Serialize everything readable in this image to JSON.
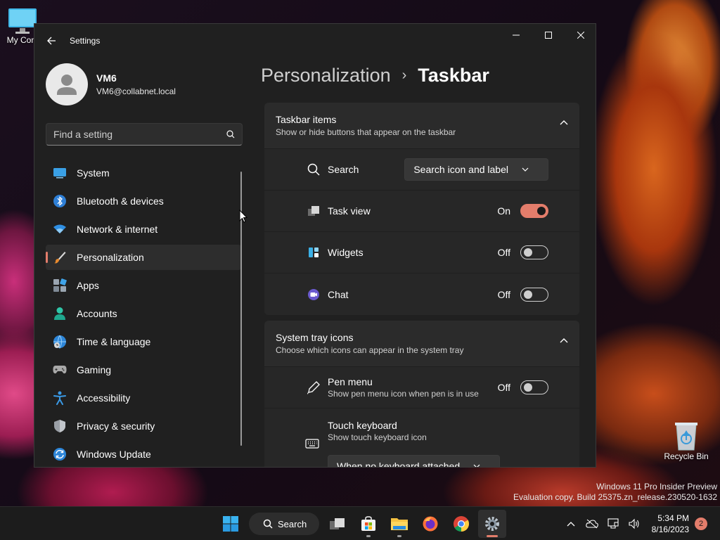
{
  "desktop": {
    "my_computer_label": "My Com",
    "recycle_bin_label": "Recycle Bin"
  },
  "window": {
    "title": "Settings",
    "user": {
      "name": "VM6",
      "email": "VM6@collabnet.local"
    },
    "search": {
      "placeholder": "Find a setting",
      "value": ""
    },
    "nav": [
      {
        "label": "System",
        "icon": "monitor-icon"
      },
      {
        "label": "Bluetooth & devices",
        "icon": "bluetooth-icon"
      },
      {
        "label": "Network & internet",
        "icon": "wifi-icon"
      },
      {
        "label": "Personalization",
        "icon": "paintbrush-icon",
        "active": true
      },
      {
        "label": "Apps",
        "icon": "apps-icon"
      },
      {
        "label": "Accounts",
        "icon": "person-icon"
      },
      {
        "label": "Time & language",
        "icon": "globe-clock-icon"
      },
      {
        "label": "Gaming",
        "icon": "gamepad-icon"
      },
      {
        "label": "Accessibility",
        "icon": "accessibility-icon"
      },
      {
        "label": "Privacy & security",
        "icon": "shield-icon"
      },
      {
        "label": "Windows Update",
        "icon": "update-icon"
      }
    ],
    "breadcrumb": {
      "parent": "Personalization",
      "separator": "›",
      "current": "Taskbar"
    },
    "taskbar_items": {
      "title": "Taskbar items",
      "subtitle": "Show or hide buttons that appear on the taskbar",
      "search": {
        "label": "Search",
        "value": "Search icon and label"
      },
      "task_view": {
        "label": "Task view",
        "state": "On"
      },
      "widgets": {
        "label": "Widgets",
        "state": "Off"
      },
      "chat": {
        "label": "Chat",
        "state": "Off"
      }
    },
    "system_tray": {
      "title": "System tray icons",
      "subtitle": "Choose which icons can appear in the system tray",
      "pen_menu": {
        "label": "Pen menu",
        "sub": "Show pen menu icon when pen is in use",
        "state": "Off"
      },
      "touch_keyboard": {
        "label": "Touch keyboard",
        "sub": "Show touch keyboard icon",
        "value": "When no keyboard attached"
      }
    }
  },
  "watermark": {
    "line1": "Windows 11 Pro Insider Preview",
    "line2": "Evaluation copy. Build 25375.zn_release.230520-1632"
  },
  "taskbar": {
    "search_label": "Search",
    "time": "5:34 PM",
    "date": "8/16/2023",
    "notification_count": "2"
  },
  "colors": {
    "accent": "#e37d6b",
    "window_bg": "#202020",
    "card_bg": "#2b2b2b"
  }
}
